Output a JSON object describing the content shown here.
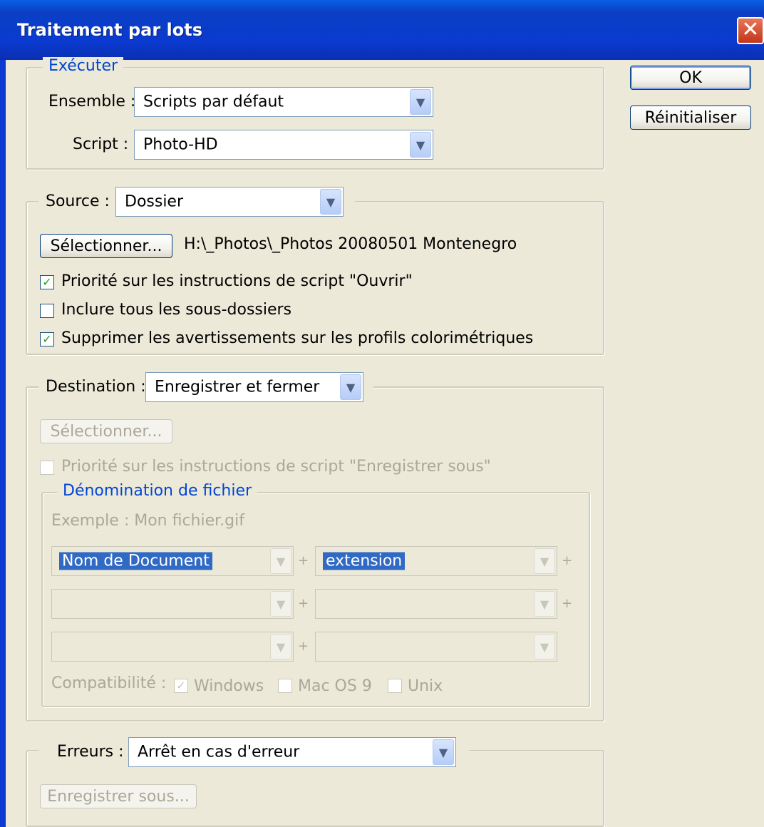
{
  "dialog": {
    "title": "Traitement par lots"
  },
  "buttons": {
    "ok": "OK",
    "reset": "Réinitialiser"
  },
  "executer": {
    "legend": "Exécuter",
    "ensemble_label": "Ensemble :",
    "ensemble_value": "Scripts par défaut",
    "script_label": "Script :",
    "script_value": "Photo-HD"
  },
  "source": {
    "label": "Source :",
    "value": "Dossier",
    "select_button": "Sélectionner...",
    "path": "H:\\_Photos\\_Photos 20080501 Montenegro",
    "options": [
      {
        "label": "Priorité sur les instructions de script \"Ouvrir\"",
        "checked": true
      },
      {
        "label": "Inclure tous les sous-dossiers",
        "checked": false
      },
      {
        "label": "Supprimer les avertissements sur les profils colorimétriques",
        "checked": true
      }
    ]
  },
  "destination": {
    "label": "Destination :",
    "value": "Enregistrer et fermer",
    "select_button": "Sélectionner...",
    "override_label": "Priorité sur les instructions de script \"Enregistrer sous\"",
    "override_checked": false,
    "naming": {
      "legend": "Dénomination de fichier",
      "example": "Exemple : Mon fichier.gif",
      "fields": [
        "Nom de Document",
        "extension",
        "",
        "",
        "",
        ""
      ],
      "plus": "+",
      "compat_label": "Compatibilité :",
      "compat": [
        {
          "label": "Windows",
          "checked": true
        },
        {
          "label": "Mac OS 9",
          "checked": false
        },
        {
          "label": "Unix",
          "checked": false
        }
      ]
    }
  },
  "errors": {
    "label": "Erreurs :",
    "value": "Arrêt en cas d'erreur",
    "save_as_button": "Enregistrer sous..."
  }
}
